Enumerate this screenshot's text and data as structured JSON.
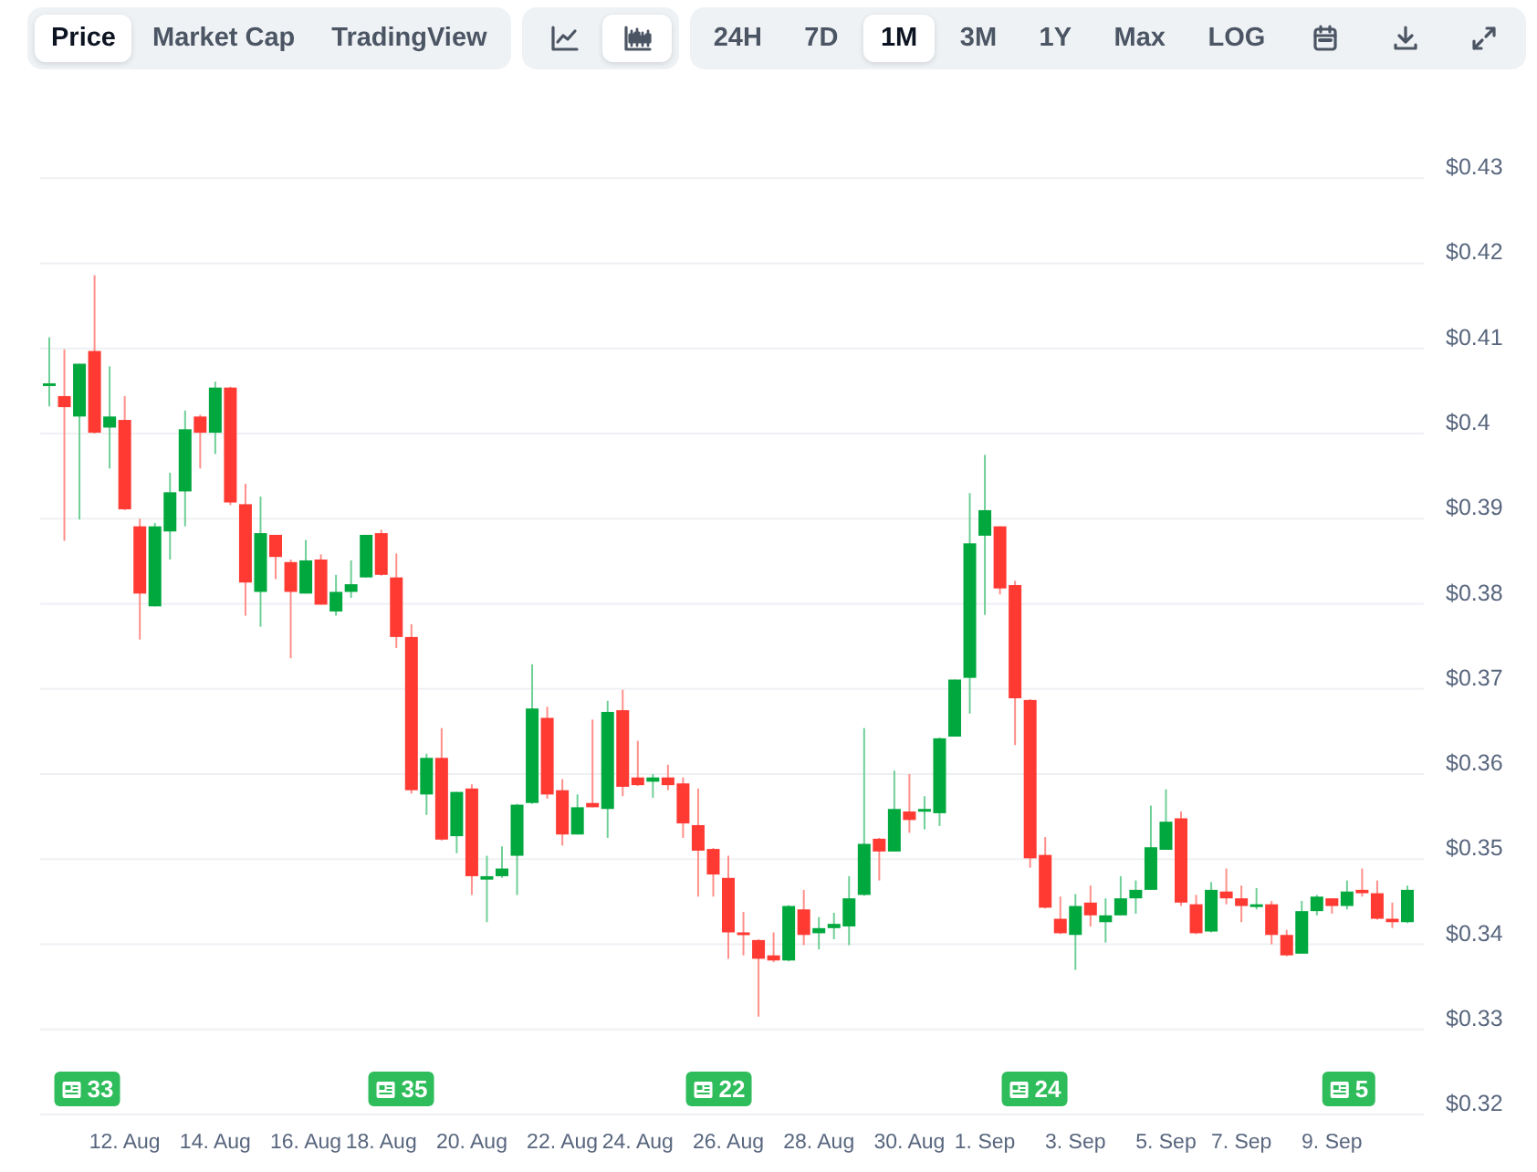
{
  "view_tabs": [
    {
      "label": "Price",
      "selected": true
    },
    {
      "label": "Market Cap",
      "selected": false
    },
    {
      "label": "TradingView",
      "selected": false
    }
  ],
  "chart_type_buttons": [
    {
      "kind": "line",
      "selected": false
    },
    {
      "kind": "candlestick",
      "selected": true
    }
  ],
  "range_tabs": [
    {
      "label": "24H",
      "selected": false
    },
    {
      "label": "7D",
      "selected": false
    },
    {
      "label": "1M",
      "selected": true
    },
    {
      "label": "3M",
      "selected": false
    },
    {
      "label": "1Y",
      "selected": false
    },
    {
      "label": "Max",
      "selected": false
    },
    {
      "label": "LOG",
      "selected": false
    }
  ],
  "price_chart": {
    "chart_data": {
      "type": "candlestick",
      "grid": true,
      "ylim": [
        0.32,
        0.43
      ],
      "yticks": [
        {
          "value": 0.43,
          "label": "$0.43"
        },
        {
          "value": 0.42,
          "label": "$0.42"
        },
        {
          "value": 0.41,
          "label": "$0.41"
        },
        {
          "value": 0.4,
          "label": "$0.4"
        },
        {
          "value": 0.39,
          "label": "$0.39"
        },
        {
          "value": 0.38,
          "label": "$0.38"
        },
        {
          "value": 0.37,
          "label": "$0.37"
        },
        {
          "value": 0.36,
          "label": "$0.36"
        },
        {
          "value": 0.35,
          "label": "$0.35"
        },
        {
          "value": 0.34,
          "label": "$0.34"
        },
        {
          "value": 0.33,
          "label": "$0.33"
        },
        {
          "value": 0.32,
          "label": "$0.32"
        }
      ],
      "categories": [
        null,
        null,
        null,
        null,
        null,
        "12. Aug",
        null,
        null,
        null,
        null,
        null,
        "14. Aug",
        null,
        null,
        null,
        null,
        null,
        "16. Aug",
        null,
        null,
        null,
        null,
        "18. Aug",
        null,
        null,
        null,
        null,
        null,
        "20. Aug",
        null,
        null,
        null,
        null,
        null,
        "22. Aug",
        null,
        null,
        null,
        null,
        "24. Aug",
        null,
        null,
        null,
        null,
        null,
        "26. Aug",
        null,
        null,
        null,
        null,
        null,
        "28. Aug",
        null,
        null,
        null,
        null,
        null,
        "30. Aug",
        null,
        null,
        null,
        null,
        "1. Sep",
        null,
        null,
        null,
        null,
        null,
        "3. Sep",
        null,
        null,
        null,
        null,
        null,
        "5. Sep",
        null,
        null,
        null,
        null,
        "7. Sep",
        null,
        null,
        null,
        null,
        null,
        "9. Sep",
        null,
        null,
        null,
        null,
        null
      ],
      "ohlc": [
        [
          0.4058,
          0.4113,
          0.4032,
          0.4059
        ],
        [
          0.4044,
          0.4099,
          0.3874,
          0.4031
        ],
        [
          0.402,
          0.4082,
          0.3899,
          0.4082
        ],
        [
          0.4097,
          0.4186,
          0.4,
          0.4001
        ],
        [
          0.4007,
          0.4079,
          0.3959,
          0.402
        ],
        [
          0.4016,
          0.4044,
          0.391,
          0.3911
        ],
        [
          0.3891,
          0.39,
          0.3758,
          0.3812
        ],
        [
          0.3797,
          0.3895,
          0.3797,
          0.3891
        ],
        [
          0.3885,
          0.3954,
          0.3852,
          0.3931
        ],
        [
          0.3932,
          0.4027,
          0.3891,
          0.4005
        ],
        [
          0.402,
          0.4022,
          0.3959,
          0.4001
        ],
        [
          0.4001,
          0.4061,
          0.3976,
          0.4054
        ],
        [
          0.4054,
          0.4055,
          0.3916,
          0.3919
        ],
        [
          0.3917,
          0.3941,
          0.3786,
          0.3825
        ],
        [
          0.3814,
          0.3926,
          0.3773,
          0.3883
        ],
        [
          0.3881,
          0.3881,
          0.3829,
          0.3855
        ],
        [
          0.3849,
          0.3852,
          0.3736,
          0.3814
        ],
        [
          0.3812,
          0.3875,
          0.3812,
          0.3851
        ],
        [
          0.3852,
          0.3858,
          0.3799,
          0.3799
        ],
        [
          0.3791,
          0.3834,
          0.3786,
          0.3814
        ],
        [
          0.3814,
          0.3851,
          0.3807,
          0.3823
        ],
        [
          0.3831,
          0.3881,
          0.3831,
          0.3881
        ],
        [
          0.3883,
          0.3887,
          0.3833,
          0.3834
        ],
        [
          0.3831,
          0.3859,
          0.3748,
          0.3761
        ],
        [
          0.3761,
          0.3776,
          0.3577,
          0.3581
        ],
        [
          0.3576,
          0.3624,
          0.3552,
          0.3619
        ],
        [
          0.3619,
          0.3654,
          0.3522,
          0.3523
        ],
        [
          0.3527,
          0.3579,
          0.3507,
          0.3579
        ],
        [
          0.3583,
          0.3588,
          0.3458,
          0.348
        ],
        [
          0.3476,
          0.3504,
          0.3426,
          0.348
        ],
        [
          0.348,
          0.3515,
          0.3478,
          0.3489
        ],
        [
          0.3504,
          0.3565,
          0.3458,
          0.3564
        ],
        [
          0.3566,
          0.3729,
          0.3565,
          0.3677
        ],
        [
          0.3666,
          0.3679,
          0.3571,
          0.3576
        ],
        [
          0.3581,
          0.3594,
          0.3516,
          0.3529
        ],
        [
          0.3529,
          0.3576,
          0.3529,
          0.3561
        ],
        [
          0.3566,
          0.3664,
          0.3561,
          0.3561
        ],
        [
          0.3559,
          0.3686,
          0.3525,
          0.3673
        ],
        [
          0.3675,
          0.3699,
          0.3574,
          0.3585
        ],
        [
          0.3596,
          0.3639,
          0.3586,
          0.3587
        ],
        [
          0.3591,
          0.36,
          0.3572,
          0.3596
        ],
        [
          0.3596,
          0.3611,
          0.3581,
          0.3587
        ],
        [
          0.3589,
          0.3596,
          0.3525,
          0.3542
        ],
        [
          0.354,
          0.3583,
          0.3456,
          0.351
        ],
        [
          0.3512,
          0.3513,
          0.3456,
          0.3482
        ],
        [
          0.3478,
          0.3504,
          0.3383,
          0.3414
        ],
        [
          0.3414,
          0.3438,
          0.3387,
          0.3411
        ],
        [
          0.3405,
          0.3406,
          0.3315,
          0.3383
        ],
        [
          0.3387,
          0.3414,
          0.3379,
          0.3381
        ],
        [
          0.3381,
          0.3446,
          0.338,
          0.3445
        ],
        [
          0.3441,
          0.3464,
          0.3399,
          0.3411
        ],
        [
          0.3413,
          0.3432,
          0.3394,
          0.3419
        ],
        [
          0.3419,
          0.3437,
          0.3406,
          0.3424
        ],
        [
          0.3421,
          0.348,
          0.3399,
          0.3454
        ],
        [
          0.3458,
          0.3654,
          0.3457,
          0.3518
        ],
        [
          0.3524,
          0.3525,
          0.3475,
          0.3509
        ],
        [
          0.3509,
          0.3604,
          0.3509,
          0.3559
        ],
        [
          0.3556,
          0.36,
          0.3531,
          0.3546
        ],
        [
          0.3556,
          0.3574,
          0.3535,
          0.3559
        ],
        [
          0.3554,
          0.3643,
          0.3539,
          0.3642
        ],
        [
          0.3644,
          0.3711,
          0.3644,
          0.3711
        ],
        [
          0.3713,
          0.393,
          0.3671,
          0.3871
        ],
        [
          0.388,
          0.3975,
          0.3787,
          0.391
        ],
        [
          0.3891,
          0.3891,
          0.3811,
          0.3818
        ],
        [
          0.3822,
          0.3827,
          0.3634,
          0.3689
        ],
        [
          0.3687,
          0.3688,
          0.349,
          0.3501
        ],
        [
          0.3505,
          0.3526,
          0.3442,
          0.3443
        ],
        [
          0.343,
          0.3456,
          0.3412,
          0.3413
        ],
        [
          0.3411,
          0.3459,
          0.337,
          0.3445
        ],
        [
          0.3449,
          0.3469,
          0.3421,
          0.3434
        ],
        [
          0.3426,
          0.3454,
          0.3402,
          0.3434
        ],
        [
          0.3434,
          0.348,
          0.3434,
          0.3454
        ],
        [
          0.3454,
          0.3475,
          0.3436,
          0.3464
        ],
        [
          0.3464,
          0.3563,
          0.3464,
          0.3514
        ],
        [
          0.3511,
          0.3582,
          0.3511,
          0.3544
        ],
        [
          0.3548,
          0.3556,
          0.3445,
          0.3449
        ],
        [
          0.3447,
          0.3458,
          0.3412,
          0.3413
        ],
        [
          0.3415,
          0.3473,
          0.3414,
          0.3464
        ],
        [
          0.3462,
          0.3489,
          0.3447,
          0.3454
        ],
        [
          0.3454,
          0.3469,
          0.3426,
          0.3445
        ],
        [
          0.3445,
          0.3466,
          0.3441,
          0.3447
        ],
        [
          0.3447,
          0.3451,
          0.34,
          0.3411
        ],
        [
          0.3411,
          0.3417,
          0.3386,
          0.3387
        ],
        [
          0.3389,
          0.3451,
          0.3389,
          0.3439
        ],
        [
          0.3439,
          0.3458,
          0.3434,
          0.3456
        ],
        [
          0.3454,
          0.3454,
          0.3436,
          0.3445
        ],
        [
          0.3445,
          0.3475,
          0.3441,
          0.3462
        ],
        [
          0.3464,
          0.3489,
          0.3456,
          0.346
        ],
        [
          0.346,
          0.3475,
          0.3429,
          0.343
        ],
        [
          0.343,
          0.3449,
          0.3419,
          0.3426
        ],
        [
          0.3426,
          0.3469,
          0.3425,
          0.3464
        ]
      ],
      "annotations": [
        "33",
        "35",
        "22",
        "24",
        "5"
      ]
    }
  }
}
